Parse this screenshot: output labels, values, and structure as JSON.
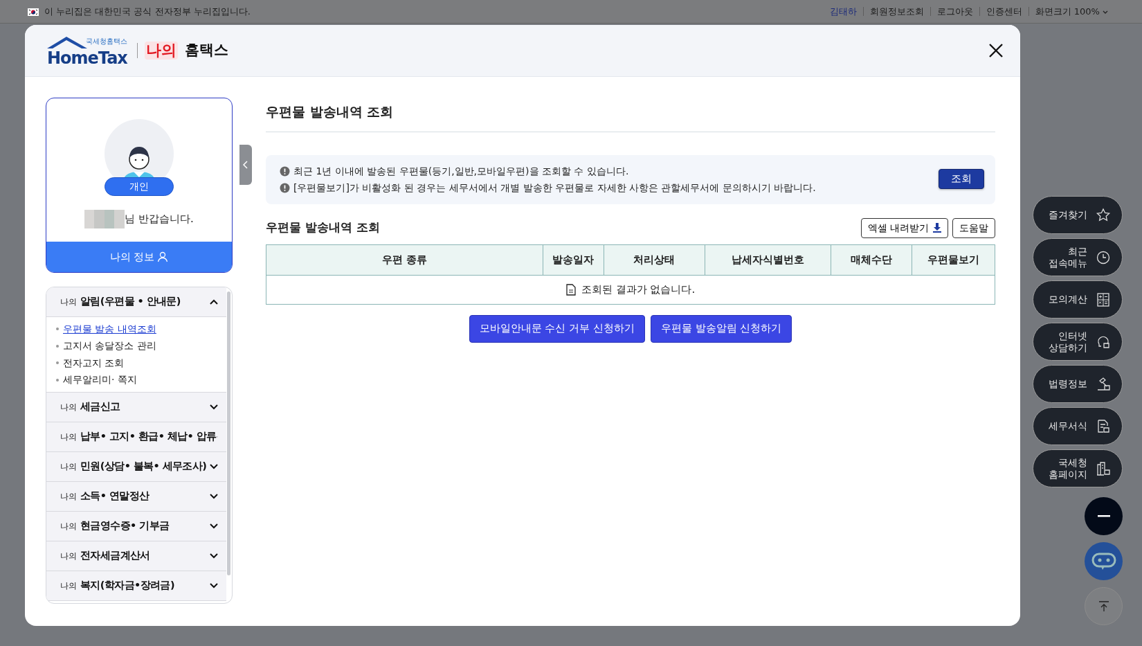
{
  "gov_banner": {
    "text": "이 누리집은 대한민국 공식 전자정부 누리집입니다."
  },
  "top_links": [
    {
      "label": "김태하",
      "kind": "user"
    },
    {
      "label": "회원정보조회",
      "kind": "link"
    },
    {
      "label": "로그아웃",
      "kind": "link"
    },
    {
      "label": "인증센터",
      "kind": "link"
    },
    {
      "label": "화면크기 100%",
      "kind": "dropdown"
    }
  ],
  "modal": {
    "logo_small": "국세청홈택스",
    "logo": "HomeTax",
    "title_accent": "나의",
    "title": "홈택스"
  },
  "profile": {
    "badge": "개인",
    "greeting": "님 반갑습니다.",
    "button": "나의 정보"
  },
  "menu": [
    {
      "prefix": "나의",
      "label": "알림(우편물 • 안내문)",
      "expanded": true,
      "children": [
        {
          "label": "우편물 발송 내역조회",
          "selected": true
        },
        {
          "label": "고지서 송달장소 관리",
          "selected": false
        },
        {
          "label": "전자고지 조회",
          "selected": false
        },
        {
          "label": "세무알리미· 쪽지",
          "selected": false
        }
      ]
    },
    {
      "prefix": "나의",
      "label": "세금신고",
      "expanded": false
    },
    {
      "prefix": "나의",
      "label": "납부• 고지• 환급• 체납• 압류",
      "expanded": false
    },
    {
      "prefix": "나의",
      "label": "민원(상담• 불복• 세무조사)",
      "expanded": false
    },
    {
      "prefix": "나의",
      "label": "소득• 연말정산",
      "expanded": false
    },
    {
      "prefix": "나의",
      "label": "현금영수증• 기부금",
      "expanded": false
    },
    {
      "prefix": "나의",
      "label": "전자세금계산서",
      "expanded": false
    },
    {
      "prefix": "나의",
      "label": "복지(학자금•장려금)",
      "expanded": false
    }
  ],
  "page": {
    "title": "우편물 발송내역 조회",
    "notices": [
      "최근 1년 이내에 발송된 우편물(등기,일반,모바일우편)을 조회할 수 있습니다.",
      "[우편물보기]가 비활성화 된 경우는 세무서에서 개별 발송한 우편물로 자세한 사항은 관할세무서에 문의하시기 바랍니다."
    ],
    "search_button": "조회",
    "section_title": "우편물 발송내역 조회",
    "excel_button": "엑셀 내려받기",
    "help_button": "도움말",
    "table": {
      "columns": [
        "우편 종류",
        "발송일자",
        "처리상태",
        "납세자식별번호",
        "매체수단",
        "우편물보기"
      ],
      "empty_message": "조회된 결과가 없습니다."
    },
    "actions": [
      "모바일안내문 수신 거부 신청하기",
      "우편물 발송알림 신청하기"
    ]
  },
  "quick_menu": [
    "즐겨찾기",
    "최근\n접속메뉴",
    "모의계산",
    "인터넷\n상담하기",
    "법령정보",
    "세무서식",
    "국세청\n홈페이지"
  ]
}
